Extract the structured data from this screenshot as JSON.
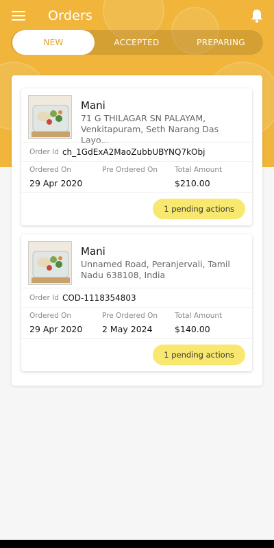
{
  "header": {
    "title": "Orders",
    "icons": {
      "menu": "menu-icon",
      "notifications": "bell-icon"
    }
  },
  "tabs": [
    {
      "label": "NEW",
      "active": true
    },
    {
      "label": "ACCEPTED",
      "active": false
    },
    {
      "label": "PREPARING",
      "active": false
    }
  ],
  "labels": {
    "order_id": "Order Id",
    "ordered_on": "Ordered On",
    "pre_ordered_on": "Pre Ordered On",
    "total_amount": "Total Amount"
  },
  "orders": [
    {
      "customer": "Mani",
      "address": "71 G THILAGAR SN PALAYAM, Venkitapuram, Seth Narang Das Layo...",
      "order_id": "ch_1GdExA2MaoZubbUBYNQ7kObj",
      "ordered_on": "29 Apr 2020",
      "pre_ordered_on": "",
      "total_amount": "$210.00",
      "pending": "1 pending actions"
    },
    {
      "customer": "Mani",
      "address": "Unnamed Road, Peranjervali, Tamil Nadu 638108, India",
      "order_id": "COD-1118354803",
      "ordered_on": "29 Apr 2020",
      "pre_ordered_on": "2 May 2024",
      "total_amount": "$140.00",
      "pending": "1 pending actions"
    }
  ],
  "colors": {
    "header_bg": "#f0b53a",
    "tab_active_text": "#e0a52e",
    "pending_bg": "#f9e86f"
  }
}
